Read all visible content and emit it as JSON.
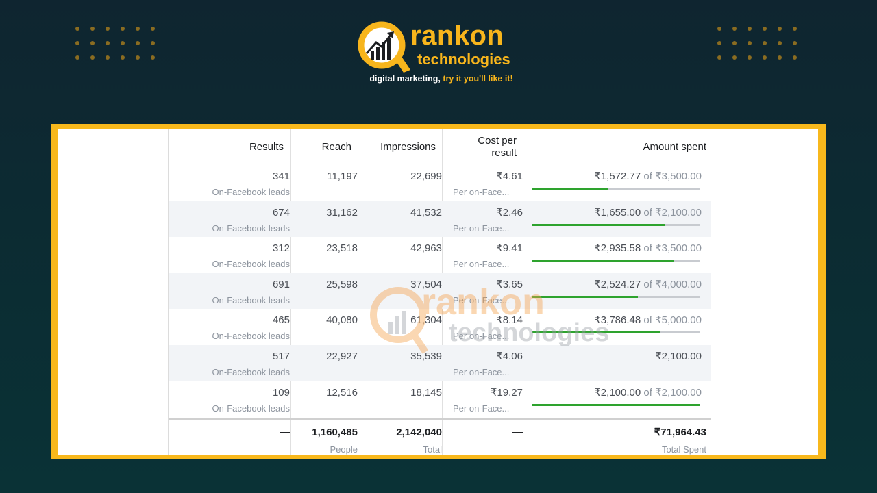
{
  "brand": {
    "name_line1": "rankon",
    "name_line2": "technologies",
    "tagline_white": "digital marketing, ",
    "tagline_yellow": "try it you'll like it!",
    "accent": "#f7b51c"
  },
  "table": {
    "headers": {
      "results": "Results",
      "reach": "Reach",
      "impressions": "Impressions",
      "cost_line1": "Cost per",
      "cost_line2": "result",
      "amount": "Amount spent"
    },
    "rows": [
      {
        "results": "341",
        "results_sub": "On-Facebook leads",
        "reach": "11,197",
        "impressions": "22,699",
        "cost": "₹4.61",
        "cost_sub": "Per on-Face...",
        "spent": "₹1,572.77",
        "of": " of ",
        "budget": "₹3,500.00",
        "progress": 0.45
      },
      {
        "results": "674",
        "results_sub": "On-Facebook leads",
        "reach": "31,162",
        "impressions": "41,532",
        "cost": "₹2.46",
        "cost_sub": "Per on-Face...",
        "spent": "₹1,655.00",
        "of": " of ",
        "budget": "₹2,100.00",
        "progress": 0.79
      },
      {
        "results": "312",
        "results_sub": "On-Facebook leads",
        "reach": "23,518",
        "impressions": "42,963",
        "cost": "₹9.41",
        "cost_sub": "Per on-Face...",
        "spent": "₹2,935.58",
        "of": " of ",
        "budget": "₹3,500.00",
        "progress": 0.84
      },
      {
        "results": "691",
        "results_sub": "On-Facebook leads",
        "reach": "25,598",
        "impressions": "37,504",
        "cost": "₹3.65",
        "cost_sub": "Per on-Face...",
        "spent": "₹2,524.27",
        "of": " of ",
        "budget": "₹4,000.00",
        "progress": 0.63
      },
      {
        "results": "465",
        "results_sub": "On-Facebook leads",
        "reach": "40,080",
        "impressions": "61,304",
        "cost": "₹8.14",
        "cost_sub": "Per on-Face...",
        "spent": "₹3,786.48",
        "of": " of ",
        "budget": "₹5,000.00",
        "progress": 0.76
      },
      {
        "results": "517",
        "results_sub": "On-Facebook leads",
        "reach": "22,927",
        "impressions": "35,539",
        "cost": "₹4.06",
        "cost_sub": "Per on-Face...",
        "spent": "₹2,100.00",
        "of": "",
        "budget": "",
        "progress": null
      },
      {
        "results": "109",
        "results_sub": "On-Facebook leads",
        "reach": "12,516",
        "impressions": "18,145",
        "cost": "₹19.27",
        "cost_sub": "Per on-Face...",
        "spent": "₹2,100.00",
        "of": " of ",
        "budget": "₹2,100.00",
        "progress": 1.0
      }
    ],
    "totals": {
      "results": "—",
      "reach": "1,160,485",
      "reach_sub": "People",
      "impressions": "2,142,040",
      "impressions_sub": "Total",
      "cost": "—",
      "amount": "₹71,964.43",
      "amount_sub": "Total Spent"
    }
  },
  "watermark": {
    "line1": "rankon",
    "line2": "technologies"
  }
}
